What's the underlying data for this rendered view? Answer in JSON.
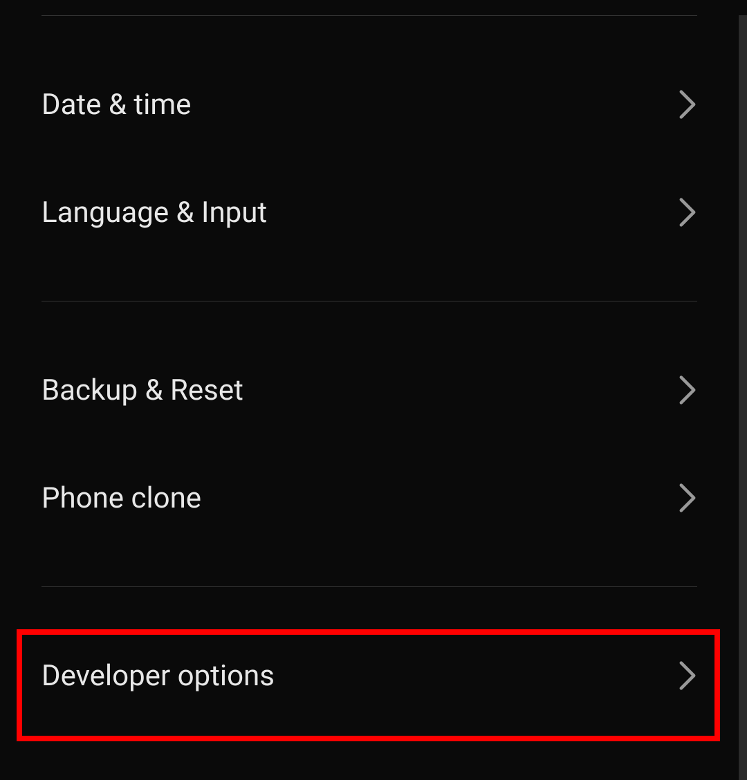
{
  "settings": {
    "groups": [
      {
        "items": [
          {
            "label": "Date & time",
            "id": "date-time"
          },
          {
            "label": "Language & Input",
            "id": "language-input"
          }
        ]
      },
      {
        "items": [
          {
            "label": "Backup & Reset",
            "id": "backup-reset"
          },
          {
            "label": "Phone clone",
            "id": "phone-clone"
          }
        ]
      },
      {
        "items": [
          {
            "label": "Developer options",
            "id": "developer-options"
          }
        ]
      }
    ]
  }
}
